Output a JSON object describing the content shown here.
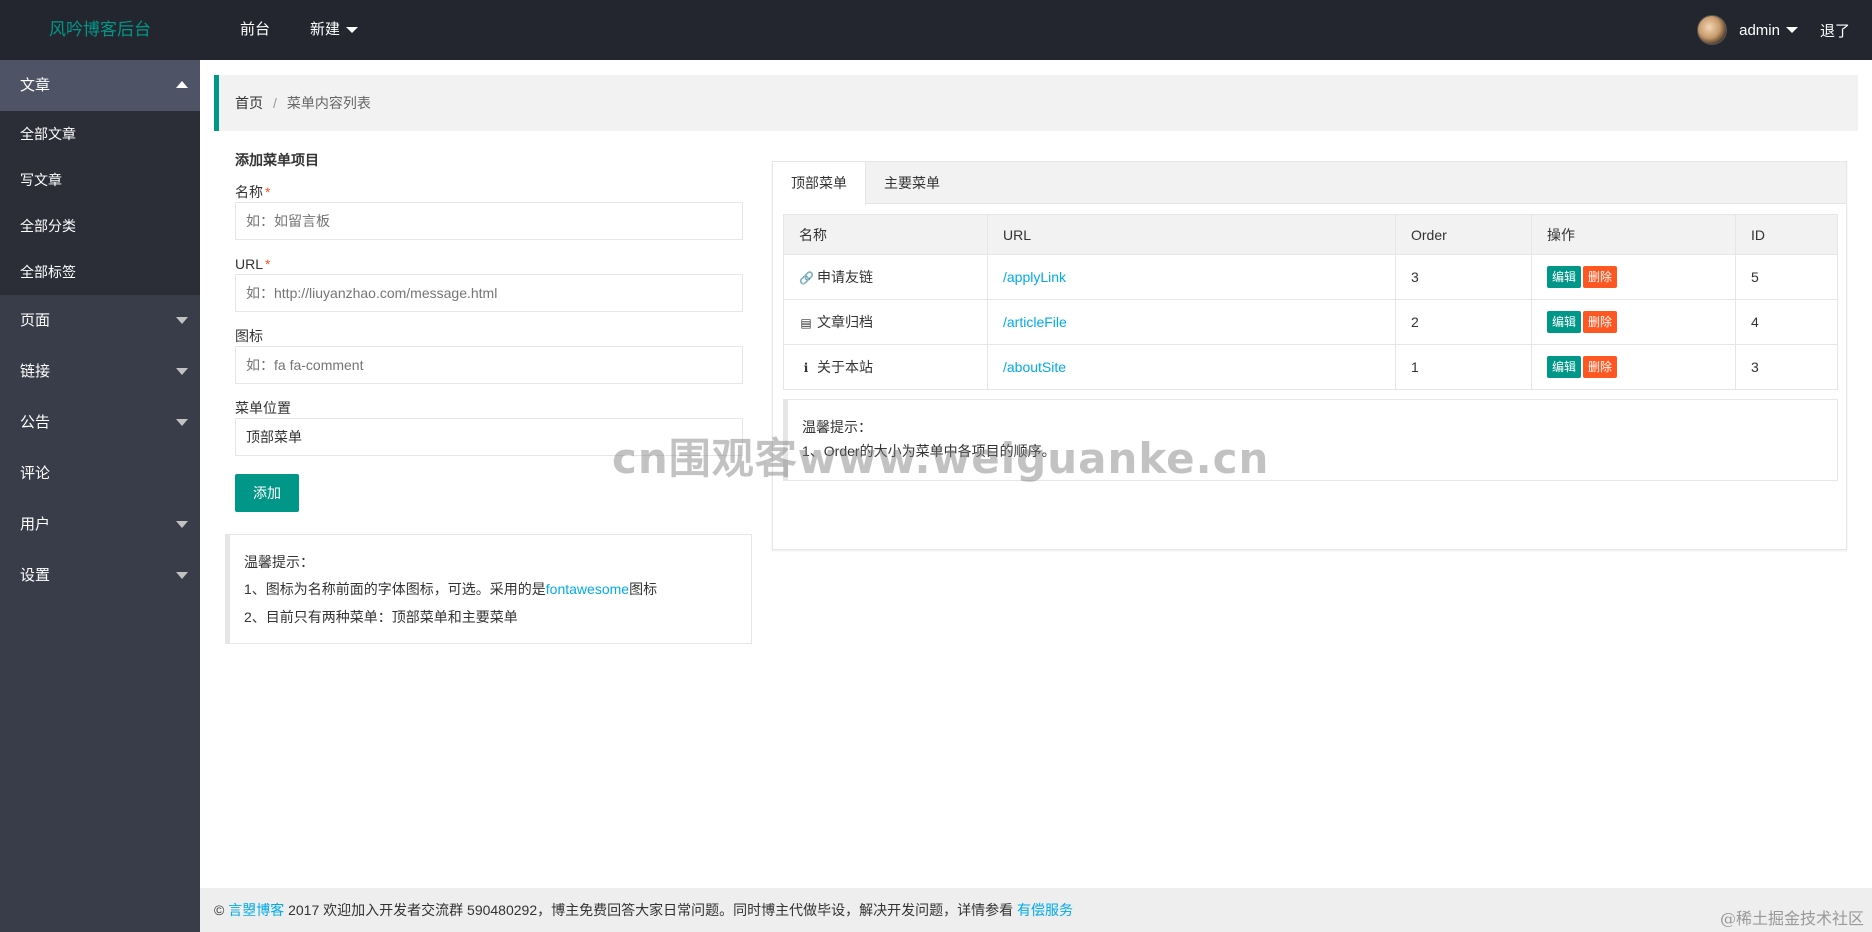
{
  "header": {
    "logo": "风吟博客后台",
    "nav": [
      {
        "label": "前台"
      },
      {
        "label": "新建"
      }
    ],
    "user_name": "admin",
    "logout": "退了"
  },
  "sidebar": {
    "groups": [
      {
        "label": "文章",
        "expanded": true,
        "items": [
          "全部文章",
          "写文章",
          "全部分类",
          "全部标签"
        ]
      },
      {
        "label": "页面"
      },
      {
        "label": "链接"
      },
      {
        "label": "公告"
      },
      {
        "label": "评论"
      },
      {
        "label": "用户"
      },
      {
        "label": "设置"
      }
    ]
  },
  "breadcrumb": {
    "home": "首页",
    "separator": "/",
    "current": "菜单内容列表"
  },
  "form": {
    "title": "添加菜单项目",
    "name_label": "名称",
    "name_placeholder": "如：如留言板",
    "url_label": "URL",
    "url_placeholder": "如：http://liuyanzhao.com/message.html",
    "icon_label": "图标",
    "icon_placeholder": "如：fa fa-comment",
    "position_label": "菜单位置",
    "position_value": "顶部菜单",
    "required_mark": "*",
    "submit_label": "添加"
  },
  "form_tip": {
    "title": "温馨提示：",
    "line1_prefix": "1、图标为名称前面的字体图标，可选。采用的是",
    "line1_link": "fontawesome",
    "line1_suffix": "图标",
    "line2": "2、目前只有两种菜单：顶部菜单和主要菜单"
  },
  "tabs": [
    {
      "label": "顶部菜单",
      "active": true
    },
    {
      "label": "主要菜单",
      "active": false
    }
  ],
  "table": {
    "columns": [
      "名称",
      "URL",
      "Order",
      "操作",
      "ID"
    ],
    "edit_label": "编辑",
    "delete_label": "删除",
    "rows": [
      {
        "icon": "link-icon",
        "name": "申请友链",
        "url": "/applyLink",
        "order": "3",
        "id": "5"
      },
      {
        "icon": "archive-icon",
        "name": "文章归档",
        "url": "/articleFile",
        "order": "2",
        "id": "4"
      },
      {
        "icon": "info-icon",
        "name": "关于本站",
        "url": "/aboutSite",
        "order": "1",
        "id": "3"
      }
    ]
  },
  "table_tip": {
    "title": "温馨提示：",
    "line1": "1、Order的大小为菜单中各项目的顺序。"
  },
  "watermark": "cn围观客www.weiguanke.cn",
  "footer": {
    "copyright": "©",
    "brand_link": "言曌博客",
    "text": "2017 欢迎加入开发者交流群 590480292，博主免费回答大家日常问题。同时博主代做毕设，解决开发问题，详情参看",
    "service_link": "有偿服务"
  },
  "corner_mark": "@稀土掘金技术社区",
  "colors": {
    "accent": "#009688",
    "danger": "#ff5722",
    "link": "#01aaed",
    "header_bg": "#23262e",
    "sidebar_bg": "#393d49"
  }
}
